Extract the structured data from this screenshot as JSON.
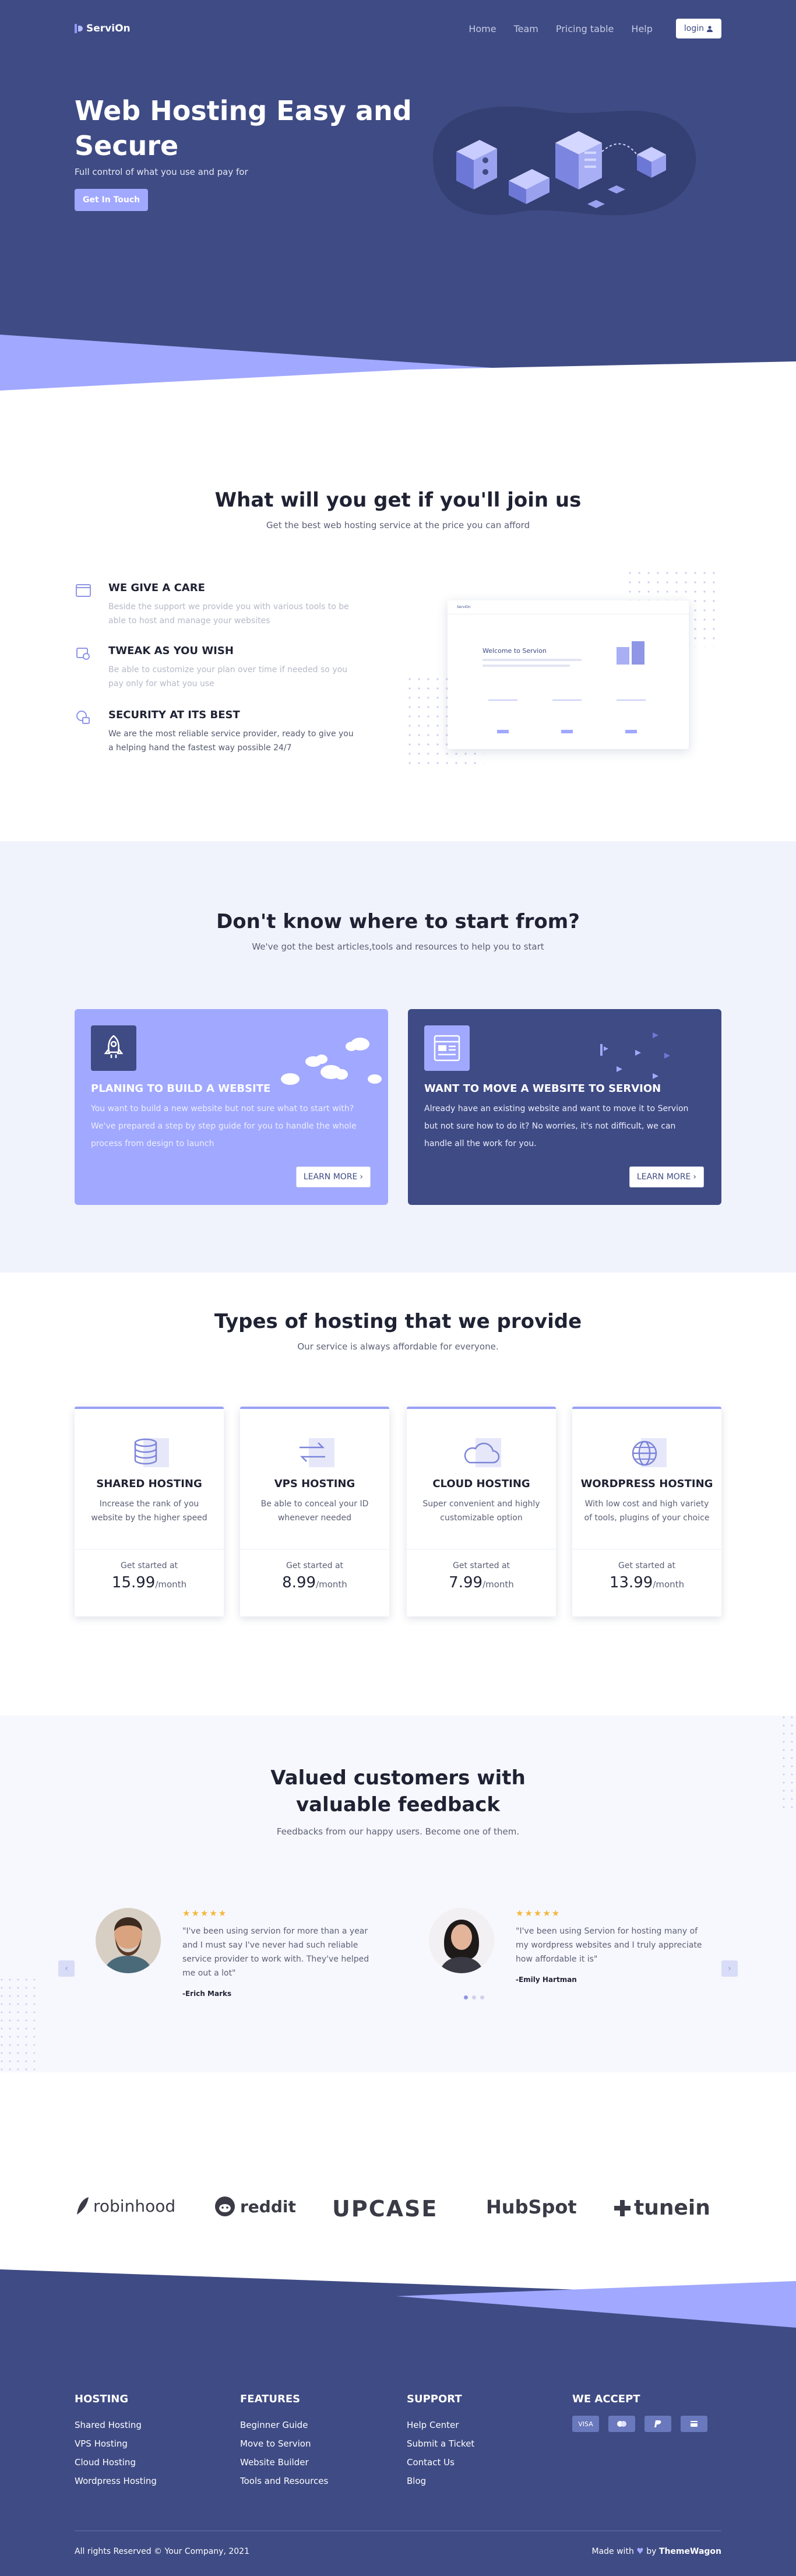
{
  "nav": {
    "brand": "ServiOn",
    "links": [
      "Home",
      "Team",
      "Pricing table",
      "Help"
    ],
    "login": "login"
  },
  "hero": {
    "title": "Web Hosting Easy and Secure",
    "subtitle": "Full control of what you use and pay for",
    "cta": "Get In Touch"
  },
  "features": {
    "title": "What will you get if you'll join us",
    "subtitle": "Get the best web hosting service at the price you can afford",
    "items": [
      {
        "title": "WE GIVE A CARE",
        "text": "Beside the support we provide you with various tools to be able to host and manage your websites"
      },
      {
        "title": "TWEAK AS YOU WISH",
        "text": "Be able to customize your plan over time if needed so you pay only for what you use"
      },
      {
        "title": "SECURITY AT ITS BEST",
        "text": "We are the most reliable service provider, ready to give you a helping hand the fastest way possible 24/7"
      }
    ],
    "mockup": {
      "brand": "ServiOn",
      "headline": "Welcome to Servion"
    }
  },
  "start": {
    "title": "Don't know where to start from?",
    "subtitle": "We've got the best articles,tools and resources to help you to start",
    "cards": [
      {
        "title": "PLANING TO BUILD A WEBSITE",
        "text": "You want to build a new website but not sure what to start with? We've prepared a step by step guide for you to handle the whole process from design to launch",
        "button": "LEARN MORE"
      },
      {
        "title": "WANT TO MOVE A WEBSITE TO SERVION",
        "text": "Already have an existing website and want to move it to Servion but not sure how to do it? No worries, it's not difficult, we can handle all the work for you.",
        "button": "LEARN MORE"
      }
    ]
  },
  "types": {
    "title": "Types of hosting that we provide",
    "subtitle": "Our service is always affordable for everyone.",
    "plans": [
      {
        "name": "SHARED HOSTING",
        "desc": "Increase the rank of you website by the higher speed",
        "started": "Get started at",
        "price": "15.99",
        "unit": "/month",
        "icon": "database-icon"
      },
      {
        "name": "VPS HOSTING",
        "desc": "Be able to conceal your ID whenever needed",
        "started": "Get started at",
        "price": "8.99",
        "unit": "/month",
        "icon": "swap-arrows-icon"
      },
      {
        "name": "CLOUD HOSTING",
        "desc": "Super convenient and highly customizable option",
        "started": "Get started at",
        "price": "7.99",
        "unit": "/month",
        "icon": "cloud-icon"
      },
      {
        "name": "WORDPRESS HOSTING",
        "desc": "With low cost and high variety of tools, plugins of your choice",
        "started": "Get started at",
        "price": "13.99",
        "unit": "/month",
        "icon": "globe-icon"
      }
    ]
  },
  "feedback": {
    "title": "Valued customers with valuable feedback",
    "subtitle": "Feedbacks from our happy users. Become one of them.",
    "stars": "★★★★★",
    "items": [
      {
        "quote": "\"I've been using servion for more than a year and I must say I've never had such reliable service provider to work with. They've helped me out a lot\"",
        "author": "-Erich Marks"
      },
      {
        "quote": "\"I've been using Servion for hosting many of my wordpress websites and I truly appreciate how affordable it is\"",
        "author": "-Emily Hartman"
      }
    ]
  },
  "brands": [
    "robinhood",
    "reddit",
    "UPCASE",
    "HubSpot",
    "tunein"
  ],
  "footer": {
    "cols": [
      {
        "title": "HOSTING",
        "links": [
          "Shared Hosting",
          "VPS Hosting",
          "Cloud Hosting",
          "Wordpress Hosting"
        ]
      },
      {
        "title": "FEATURES",
        "links": [
          "Beginner Guide",
          "Move to Servion",
          "Website Builder",
          "Tools and Resources"
        ]
      },
      {
        "title": "SUPPORT",
        "links": [
          "Help Center",
          "Submit a Ticket",
          "Contact Us",
          "Blog"
        ]
      }
    ],
    "accept_title": "WE ACCEPT",
    "payments": [
      "VISA",
      "mastercard-icon",
      "paypal-icon",
      "card-icon"
    ],
    "copyright": "All rights Reserved © Your Company, 2021",
    "made_prefix": "Made with",
    "made_by": "by",
    "made_brand": "ThemeWagon"
  },
  "colors": {
    "primary": "#3f4b84",
    "accent": "#a1a8ff",
    "light_bg": "#f1f3fc"
  }
}
